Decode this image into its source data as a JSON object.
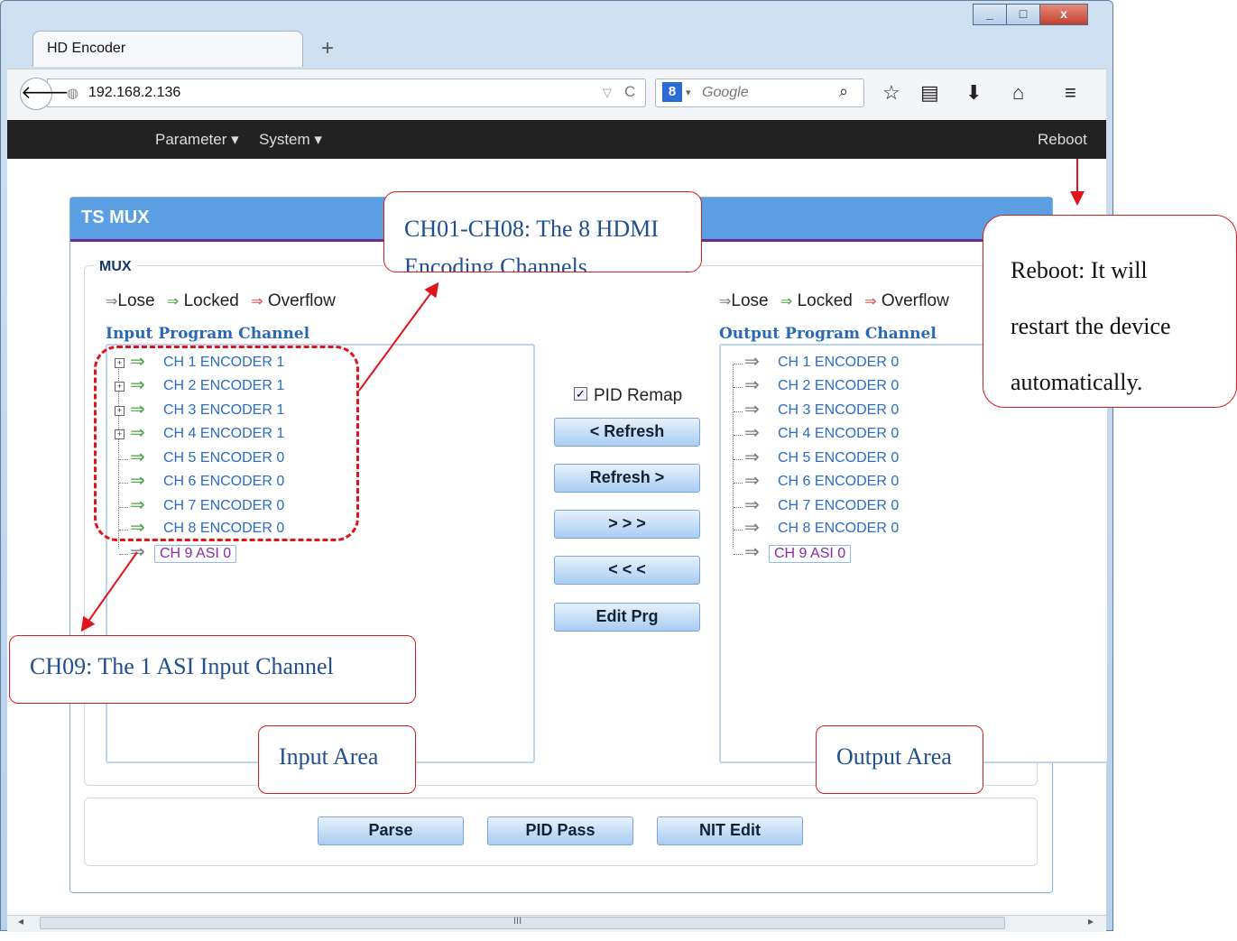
{
  "browser": {
    "tab_title": "HD Encoder",
    "new_tab": "+",
    "url": "192.168.2.136",
    "search_placeholder": "Google",
    "search_engine_badge": "8",
    "icons": [
      "back-icon",
      "globe-icon",
      "reload-icon",
      "google-search-icon",
      "search-icon",
      "bookmark-star-icon",
      "reading-list-icon",
      "download-icon",
      "home-icon",
      "menu-icon"
    ],
    "scroll_grip": "III"
  },
  "navbar": {
    "parameter": "Parameter ▾",
    "system": "System ▾",
    "reboot": "Reboot"
  },
  "panel": {
    "title": "TS MUX",
    "mux_legend": "MUX",
    "legend_lose": "Lose",
    "legend_locked": "Locked",
    "legend_overflow": "Overflow",
    "input_title": "Input Program Channel",
    "output_title": "Output Program Channel",
    "input_channels": [
      "CH 1 ENCODER 1",
      "CH 2 ENCODER 1",
      "CH 3 ENCODER 1",
      "CH 4 ENCODER 1",
      "CH 5 ENCODER 0",
      "CH 6 ENCODER 0",
      "CH 7 ENCODER 0",
      "CH 8 ENCODER 0",
      "CH 9 ASI 0"
    ],
    "output_channels": [
      "CH 1 ENCODER 0",
      "CH 2 ENCODER 0",
      "CH 3 ENCODER 0",
      "CH 4 ENCODER 0",
      "CH 5 ENCODER 0",
      "CH 6 ENCODER 0",
      "CH 7 ENCODER 0",
      "CH 8 ENCODER 0",
      "CH 9 ASI 0"
    ],
    "pid_remap": "PID Remap",
    "pid_remap_checked": true,
    "buttons": {
      "refresh_left": "< Refresh",
      "refresh_right": "Refresh >",
      "add": "> > >",
      "remove": "< < <",
      "edit_prg": "Edit Prg",
      "parse": "Parse",
      "pid_pass": "PID Pass",
      "nit_edit": "NIT Edit"
    }
  },
  "annotations": {
    "ch01_08_line1": "CH01-CH08: The 8 HDMI",
    "ch01_08_line2": "Encoding Channels",
    "reboot_line1": "Reboot: It will",
    "reboot_line2": "restart the device",
    "reboot_line3": "automatically.",
    "ch09": "CH09: The 1 ASI Input Channel",
    "input_area": "Input Area",
    "output_area": "Output Area"
  },
  "colors": {
    "panel_header": "#5b9fe2",
    "callout_border": "#d21f1f",
    "locked_arrow": "#4ca347",
    "lose_arrow": "#777777",
    "overflow_arrow": "#e8484f"
  }
}
